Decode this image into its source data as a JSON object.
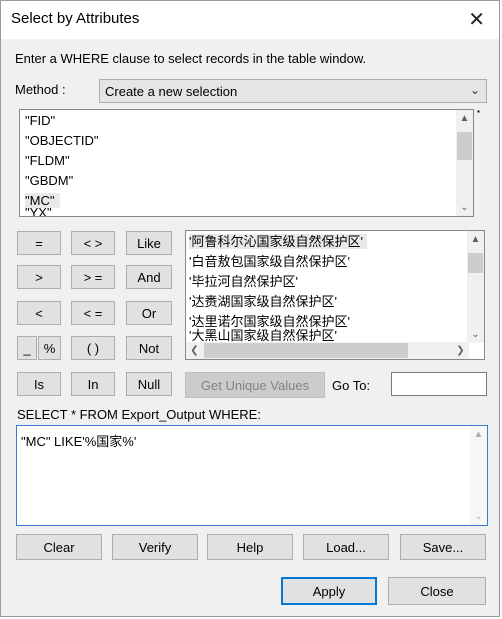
{
  "window": {
    "title": "Select by Attributes",
    "close_glyph": "✕"
  },
  "instruction": "Enter a WHERE clause to select records in the table window.",
  "method": {
    "label": "Method :",
    "value": "Create a new selection"
  },
  "fields": [
    "\"FID\"",
    "\"OBJECTID\"",
    "\"FLDM\"",
    "\"GBDM\"",
    "\"MC\"",
    "\"YX\""
  ],
  "operators": {
    "eq": "=",
    "ne": "< >",
    "like": "Like",
    "gt": ">",
    "ge": "> =",
    "and": "And",
    "lt": "<",
    "le": "< =",
    "or": "Or",
    "underscore": "_",
    "percent": "%",
    "parens": "( )",
    "not": "Not",
    "is": "Is",
    "in": "In",
    "null": "Null"
  },
  "values": [
    "'阿鲁科尔沁国家级自然保护区'",
    "'白音敖包国家级自然保护区'",
    "'毕拉河自然保护区'",
    "'达赉湖国家级自然保护区'",
    "'达里诺尔国家级自然保护区'",
    "'大黑山国家级自然保护区'"
  ],
  "get_unique_values": "Get Unique Values",
  "goto_label": "Go To:",
  "goto_value": "",
  "select_clause": "SELECT * FROM Export_Output WHERE:",
  "expression": "\"MC\" LIKE'%国家%'",
  "actions": {
    "clear": "Clear",
    "verify": "Verify",
    "help": "Help",
    "load": "Load...",
    "save": "Save..."
  },
  "dialog": {
    "apply": "Apply",
    "close": "Close"
  },
  "icons": {
    "dropdown": "chevron-down-icon",
    "up": "triangle-up-icon",
    "down": "chevron-down-icon",
    "left": "chevron-left-icon",
    "right": "chevron-right-icon"
  },
  "colors": {
    "accent": "#0078d7",
    "selection": "#e5f3ff"
  }
}
